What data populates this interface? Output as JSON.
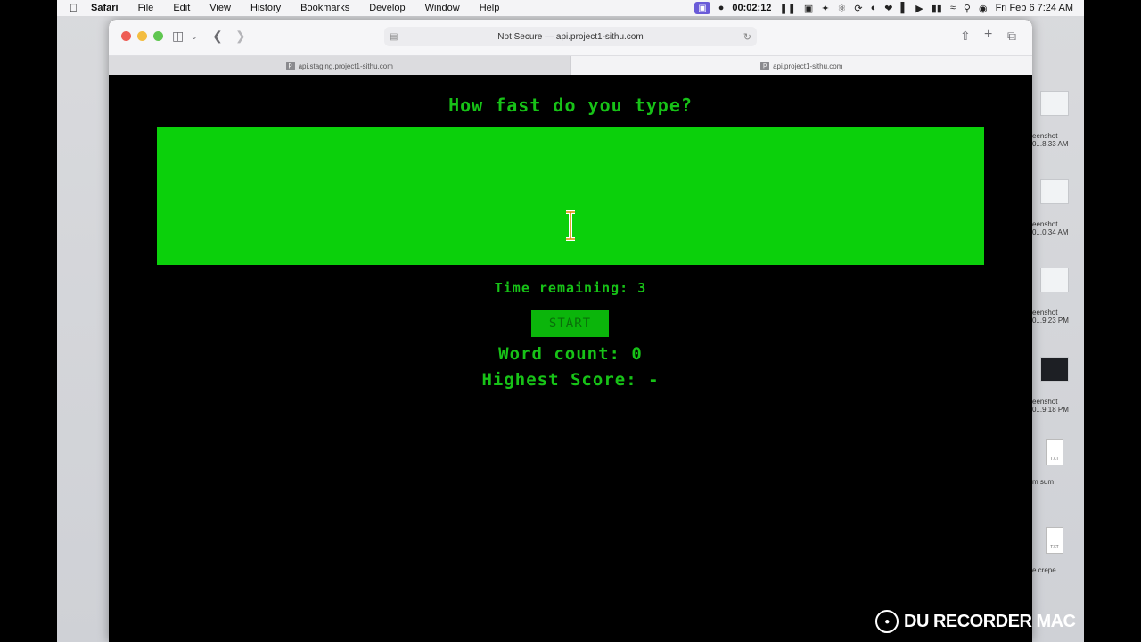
{
  "menubar": {
    "app_name": "Safari",
    "items": [
      "File",
      "Edit",
      "View",
      "History",
      "Bookmarks",
      "Develop",
      "Window",
      "Help"
    ],
    "recording_time": "00:02:12",
    "datetime": "Fri Feb 6  7:24 AM"
  },
  "browser": {
    "address": "Not Secure — api.project1-sithu.com",
    "tabs": [
      {
        "label": "api.staging.project1-sithu.com",
        "favicon": "p"
      },
      {
        "label": "api.project1-sithu.com",
        "favicon": "p"
      }
    ]
  },
  "page": {
    "heading": "How fast do you type?",
    "textarea_value": "",
    "time_remaining": "Time remaining: 3",
    "start_label": "START",
    "word_count": "Word count: 0",
    "highest_score": "Highest Score: -"
  },
  "desktop_files": [
    {
      "label": "eenshot\n0...8.33 AM"
    },
    {
      "label": "eenshot\n0...0.34 AM"
    },
    {
      "label": "eenshot\n0...9.23 PM"
    },
    {
      "label": "eenshot\n0...9.18 PM"
    },
    {
      "label": "m sum",
      "badge": "TXT"
    },
    {
      "label": "e crepe",
      "badge": "TXT"
    }
  ],
  "watermark": "DU RECORDER MAC",
  "colors": {
    "accent_green": "#0bd00b",
    "text_green": "#17c217",
    "page_bg": "#000000"
  }
}
